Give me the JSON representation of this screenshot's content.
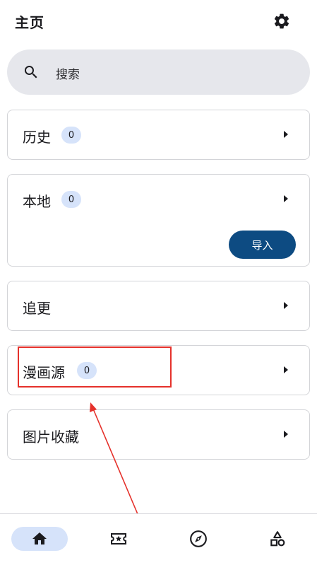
{
  "header": {
    "title": "主页"
  },
  "search": {
    "placeholder": "搜索"
  },
  "cards": {
    "history": {
      "label": "历史",
      "count": "0"
    },
    "local": {
      "label": "本地",
      "count": "0",
      "import_label": "导入"
    },
    "subscriptions": {
      "label": "追更"
    },
    "sources": {
      "label": "漫画源",
      "count": "0"
    },
    "favorites": {
      "label": "图片收藏"
    }
  },
  "bottom_nav": {
    "items": [
      {
        "icon": "home-icon",
        "active": true
      },
      {
        "icon": "ticket-star-icon",
        "active": false
      },
      {
        "icon": "compass-icon",
        "active": false
      },
      {
        "icon": "category-shapes-icon",
        "active": false
      }
    ]
  },
  "annotations": {
    "highlight_color": "#e5312b"
  }
}
